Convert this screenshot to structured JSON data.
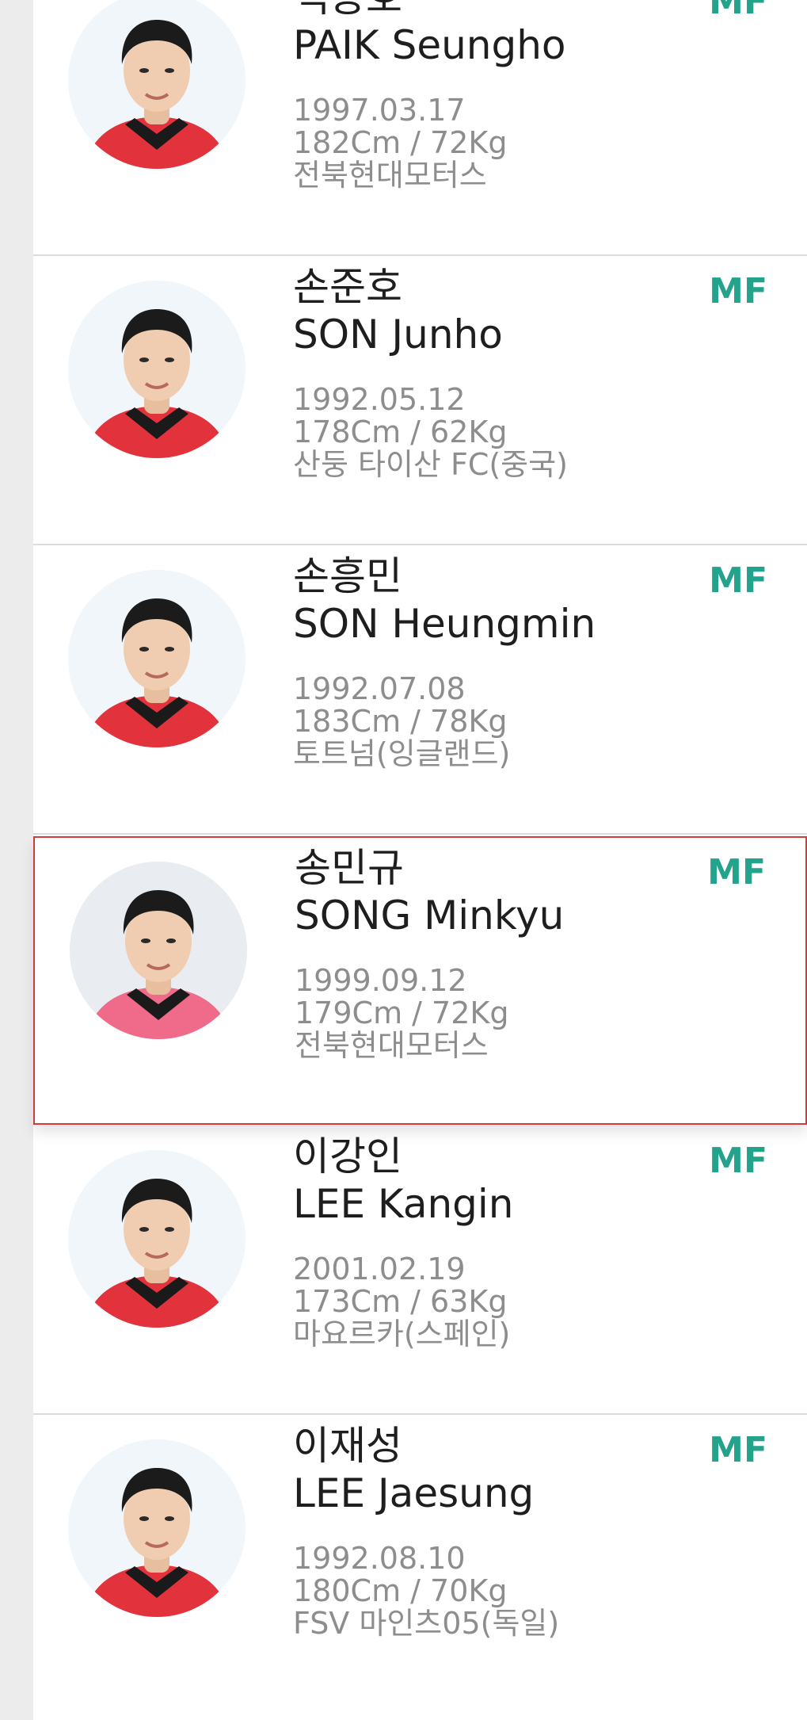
{
  "players": [
    {
      "name_ko": "백승호",
      "name_en": "PAIK Seungho",
      "birth": "1997.03.17",
      "body": "182Cm / 72Kg",
      "club": "전북현대모터스",
      "position": "MF",
      "icon": "player-photo"
    },
    {
      "name_ko": "손준호",
      "name_en": "SON Junho",
      "birth": "1992.05.12",
      "body": "178Cm / 62Kg",
      "club": "산둥 타이산 FC(중국)",
      "position": "MF",
      "icon": "player-photo"
    },
    {
      "name_ko": "손흥민",
      "name_en": "SON Heungmin",
      "birth": "1992.07.08",
      "body": "183Cm / 78Kg",
      "club": "토트넘(잉글랜드)",
      "position": "MF",
      "icon": "player-photo"
    },
    {
      "name_ko": "송민규",
      "name_en": "SONG Minkyu",
      "birth": "1999.09.12",
      "body": "179Cm / 72Kg",
      "club": "전북현대모터스",
      "position": "MF",
      "icon": "player-photo",
      "selected": true
    },
    {
      "name_ko": "이강인",
      "name_en": "LEE Kangin",
      "birth": "2001.02.19",
      "body": "173Cm / 63Kg",
      "club": "마요르카(스페인)",
      "position": "MF",
      "icon": "player-photo"
    },
    {
      "name_ko": "이재성",
      "name_en": "LEE Jaesung",
      "birth": "1992.08.10",
      "body": "180Cm / 70Kg",
      "club": "FSV 마인츠05(독일)",
      "position": "MF",
      "icon": "player-photo"
    }
  ],
  "colors": {
    "position": "#23a38c",
    "selected_border": "#d43a3a",
    "jersey": "#e2323b",
    "collar": "#1a1a1a"
  }
}
